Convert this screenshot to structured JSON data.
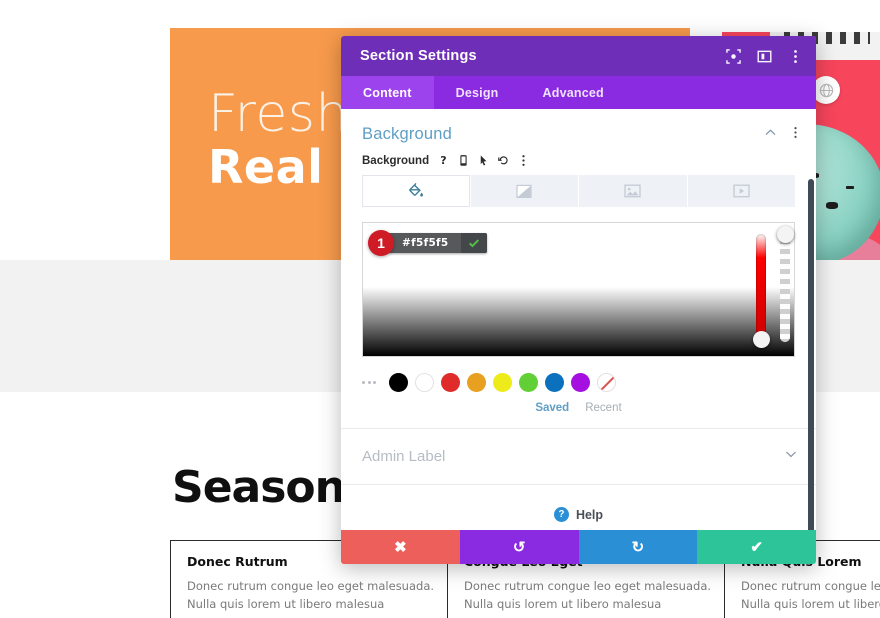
{
  "page": {
    "hero": {
      "line1": "Fresh",
      "line2": "Real F"
    },
    "section_heading": "Seasona",
    "cards": [
      {
        "title": "Donec Rutrum",
        "line1": "Donec rutrum congue leo eget malesuada.",
        "line2": "Nulla quis lorem ut libero malesua"
      },
      {
        "title": "Congue Leo Eget",
        "line1": "Donec rutrum congue leo eget malesuada.",
        "line2": "Nulla quis lorem ut libero malesua"
      },
      {
        "title": "Nulla Quis Lorem",
        "line1": "Donec rutrum congue leo eget",
        "line2": "Nulla quis lorem ut libero mal"
      }
    ],
    "colors": {
      "hero_orange": "#f79a4c",
      "hero_red": "#f7455c",
      "gray_band": "#f2f2f2",
      "ice_cream": "#9fdccf"
    }
  },
  "modal": {
    "title": "Section Settings",
    "header_icons": [
      {
        "name": "focus-target-icon"
      },
      {
        "name": "layout-panel-icon"
      },
      {
        "name": "kebab-menu-icon"
      }
    ],
    "tabs": [
      {
        "label": "Content",
        "active": true
      },
      {
        "label": "Design",
        "active": false
      },
      {
        "label": "Advanced",
        "active": false
      }
    ],
    "section": {
      "title": "Background",
      "collapse_icon": "chevron-up-icon",
      "kebab_icon": "kebab-menu-icon"
    },
    "field": {
      "label": "Background",
      "icons": [
        {
          "name": "help-question-icon",
          "glyph": "?"
        },
        {
          "name": "responsive-mobile-icon"
        },
        {
          "name": "hover-cursor-icon"
        },
        {
          "name": "reset-undo-icon"
        },
        {
          "name": "kebab-menu-icon"
        }
      ]
    },
    "background_types": [
      {
        "name": "color-fill-tab",
        "icon": "paint-bucket-icon",
        "active": true
      },
      {
        "name": "gradient-tab",
        "icon": "gradient-icon",
        "active": false
      },
      {
        "name": "image-tab",
        "icon": "image-icon",
        "active": false
      },
      {
        "name": "video-tab",
        "icon": "video-icon",
        "active": false
      }
    ],
    "color_picker": {
      "step_badge": "1",
      "hex_value": "#f5f5f5",
      "confirm_glyph": "✔",
      "hue_slider_name": "hue-slider",
      "alpha_slider_name": "alpha-slider"
    },
    "swatches": [
      {
        "name": "swatch-black",
        "color": "#000000"
      },
      {
        "name": "swatch-white",
        "color": "#ffffff"
      },
      {
        "name": "swatch-red",
        "color": "#e02b2b"
      },
      {
        "name": "swatch-orange",
        "color": "#e8a020"
      },
      {
        "name": "swatch-yellow",
        "color": "#eeeb1a"
      },
      {
        "name": "swatch-green",
        "color": "#63cf36"
      },
      {
        "name": "swatch-blue",
        "color": "#0b71bd"
      },
      {
        "name": "swatch-purple",
        "color": "#a510e0"
      },
      {
        "name": "swatch-none",
        "color": "transparent"
      }
    ],
    "palette_tabs": [
      {
        "label": "Saved",
        "active": true
      },
      {
        "label": "Recent",
        "active": false
      }
    ],
    "admin_label": "Admin Label",
    "help": {
      "glyph": "?",
      "label": "Help"
    },
    "footer_buttons": [
      {
        "name": "discard-button",
        "glyph": "✖",
        "color": "#ec5f5a"
      },
      {
        "name": "undo-button",
        "glyph": "↺",
        "color": "#8a2be2"
      },
      {
        "name": "redo-button",
        "glyph": "↻",
        "color": "#2b8fd6"
      },
      {
        "name": "save-button",
        "glyph": "✔",
        "color": "#2ec49a"
      }
    ]
  }
}
